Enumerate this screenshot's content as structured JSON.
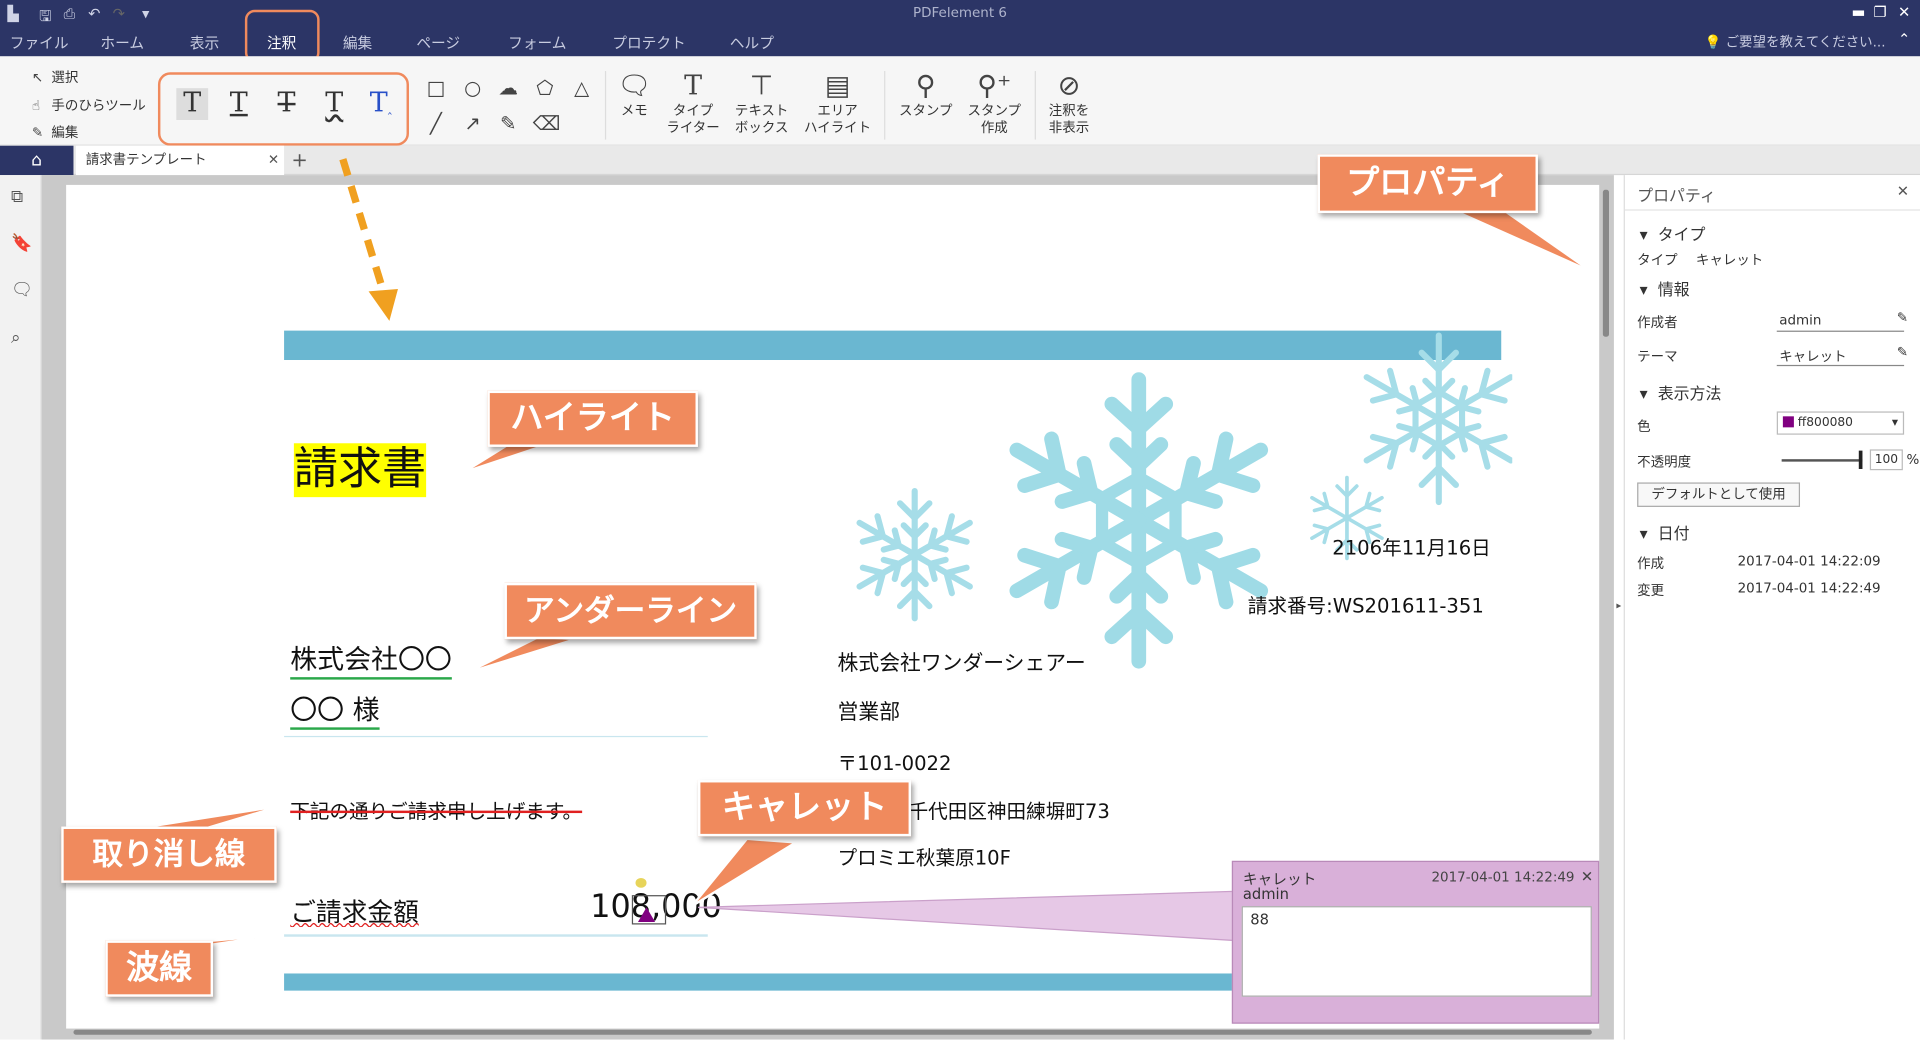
{
  "app": {
    "title": "PDFelement 6"
  },
  "menu": {
    "file": "ファイル",
    "home": "ホーム",
    "view": "表示",
    "comment": "注釈",
    "edit": "編集",
    "page": "ページ",
    "form": "フォーム",
    "protect": "プロテクト",
    "help": "ヘルプ"
  },
  "hint": "ご要望を教えてください...",
  "ribbon": {
    "select": "選択",
    "hand": "手のひらツール",
    "edit": "編集",
    "memo": "メモ",
    "typewriter": "タイプ\nライター",
    "textbox": "テキスト\nボックス",
    "area_highlight": "エリア\nハイライト",
    "stamp": "スタンプ",
    "create_stamp": "スタンプ\n作成",
    "hide_comments": "注釈を\n非表示"
  },
  "tabs": {
    "doc": "請求書テンプレート"
  },
  "document": {
    "title": "請求書",
    "company_to": "株式会社〇〇",
    "person_to": "〇〇 様",
    "date": "2106年11月16日",
    "invoice_no": "請求番号:WS201611-351",
    "company_from": "株式会社ワンダーシェアー",
    "department": "営業部",
    "zip": "〒101-0022",
    "address": "千代田区神田練塀町73",
    "building": "プロミエ秋葉原10F",
    "strike_text": "下記の通りご請求申し上げます。",
    "amount_label": "ご請求金額",
    "amount_value": "108,000"
  },
  "callouts": {
    "highlight": "ハイライト",
    "underline": "アンダーライン",
    "strike": "取り消し線",
    "caret": "キャレット",
    "squiggly": "波線",
    "properties": "プロパティ"
  },
  "popup": {
    "type": "キャレット",
    "author": "admin",
    "timestamp": "2017-04-01 14:22:49",
    "content": "88"
  },
  "properties": {
    "title": "プロパティ",
    "type_section": "タイプ",
    "type_label": "タイプ",
    "type_value": "キャレット",
    "info_section": "情報",
    "author_label": "作成者",
    "author_value": "admin",
    "theme_label": "テーマ",
    "theme_value": "キャレット",
    "display_section": "表示方法",
    "color_label": "色",
    "color_value": "ff800080",
    "opacity_label": "不透明度",
    "opacity_value": "100",
    "opacity_unit": "%",
    "default_button": "デフォルトとして使用",
    "date_section": "日付",
    "created_label": "作成",
    "created_value": "2017-04-01 14:22:09",
    "modified_label": "変更",
    "modified_value": "2017-04-01 14:22:49"
  },
  "colors": {
    "accent": "#2c3566",
    "callout": "#f08a5d",
    "band": "#6ab7d1",
    "caret": "#800080",
    "highlight": "#ffff00"
  }
}
